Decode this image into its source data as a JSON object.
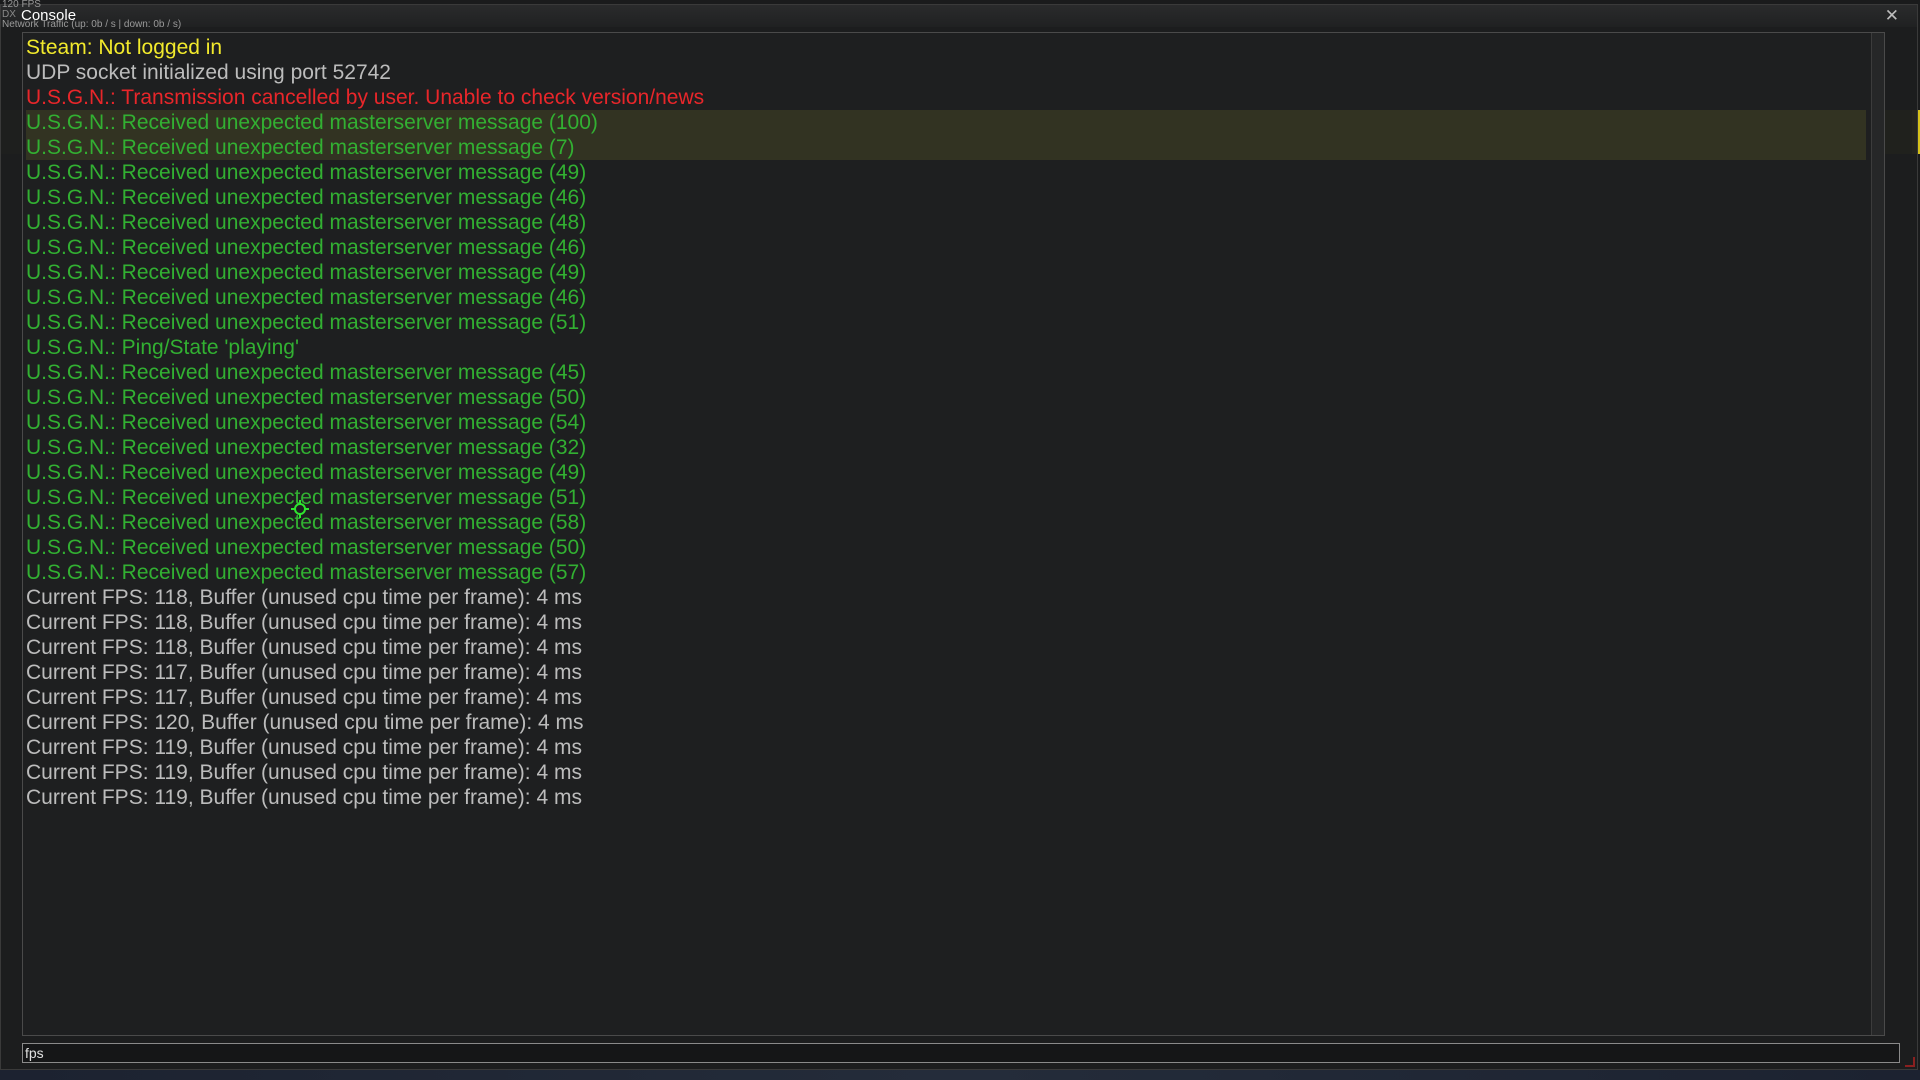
{
  "stats": {
    "fps": "120 FPS",
    "renderer": "DX",
    "network": "Network Traffic (up: 0b / s | down: 0b / s)"
  },
  "window": {
    "title": "Console",
    "close_glyph": "✕"
  },
  "log": [
    {
      "text": "Steam: Not logged in",
      "color": "yellow"
    },
    {
      "text": "UDP socket initialized using port 52742",
      "color": "grey"
    },
    {
      "text": "U.S.G.N.: Transmission cancelled by user. Unable to check version/news",
      "color": "red"
    },
    {
      "text": "U.S.G.N.: Received unexpected masterserver message (100)",
      "color": "green"
    },
    {
      "text": "U.S.G.N.: Received unexpected masterserver message (7)",
      "color": "green"
    },
    {
      "text": "U.S.G.N.: Received unexpected masterserver message (49)",
      "color": "green"
    },
    {
      "text": "U.S.G.N.: Received unexpected masterserver message (46)",
      "color": "green"
    },
    {
      "text": "U.S.G.N.: Received unexpected masterserver message (48)",
      "color": "green"
    },
    {
      "text": "U.S.G.N.: Received unexpected masterserver message (46)",
      "color": "green"
    },
    {
      "text": "U.S.G.N.: Received unexpected masterserver message (49)",
      "color": "green"
    },
    {
      "text": "U.S.G.N.: Received unexpected masterserver message (46)",
      "color": "green"
    },
    {
      "text": "U.S.G.N.: Received unexpected masterserver message (51)",
      "color": "green"
    },
    {
      "text": "U.S.G.N.: Ping/State 'playing'",
      "color": "green"
    },
    {
      "text": "U.S.G.N.: Received unexpected masterserver message (45)",
      "color": "green"
    },
    {
      "text": "U.S.G.N.: Received unexpected masterserver message (50)",
      "color": "green"
    },
    {
      "text": "U.S.G.N.: Received unexpected masterserver message (54)",
      "color": "green"
    },
    {
      "text": "U.S.G.N.: Received unexpected masterserver message (32)",
      "color": "green"
    },
    {
      "text": "U.S.G.N.: Received unexpected masterserver message (49)",
      "color": "green"
    },
    {
      "text": "U.S.G.N.: Received unexpected masterserver message (51)",
      "color": "green"
    },
    {
      "text": "U.S.G.N.: Received unexpected masterserver message (58)",
      "color": "green"
    },
    {
      "text": "U.S.G.N.: Received unexpected masterserver message (50)",
      "color": "green"
    },
    {
      "text": "U.S.G.N.: Received unexpected masterserver message (57)",
      "color": "green"
    },
    {
      "text": "Current FPS: 118, Buffer (unused cpu time per frame): 4 ms",
      "color": "grey"
    },
    {
      "text": "Current FPS: 118, Buffer (unused cpu time per frame): 4 ms",
      "color": "grey"
    },
    {
      "text": "Current FPS: 118, Buffer (unused cpu time per frame): 4 ms",
      "color": "grey"
    },
    {
      "text": "Current FPS: 117, Buffer (unused cpu time per frame): 4 ms",
      "color": "grey"
    },
    {
      "text": "Current FPS: 117, Buffer (unused cpu time per frame): 4 ms",
      "color": "grey"
    },
    {
      "text": "Current FPS: 120, Buffer (unused cpu time per frame): 4 ms",
      "color": "grey"
    },
    {
      "text": "Current FPS: 119, Buffer (unused cpu time per frame): 4 ms",
      "color": "grey"
    },
    {
      "text": "Current FPS: 119, Buffer (unused cpu time per frame): 4 ms",
      "color": "grey"
    },
    {
      "text": "Current FPS: 119, Buffer (unused cpu time per frame): 4 ms",
      "color": "grey"
    }
  ],
  "input": {
    "value": "fps"
  },
  "colors": {
    "yellow": "#f2ea2c",
    "grey": "#bcbcbc",
    "red": "#e8262a",
    "green": "#32b032",
    "crosshair": "#2ee52e"
  }
}
